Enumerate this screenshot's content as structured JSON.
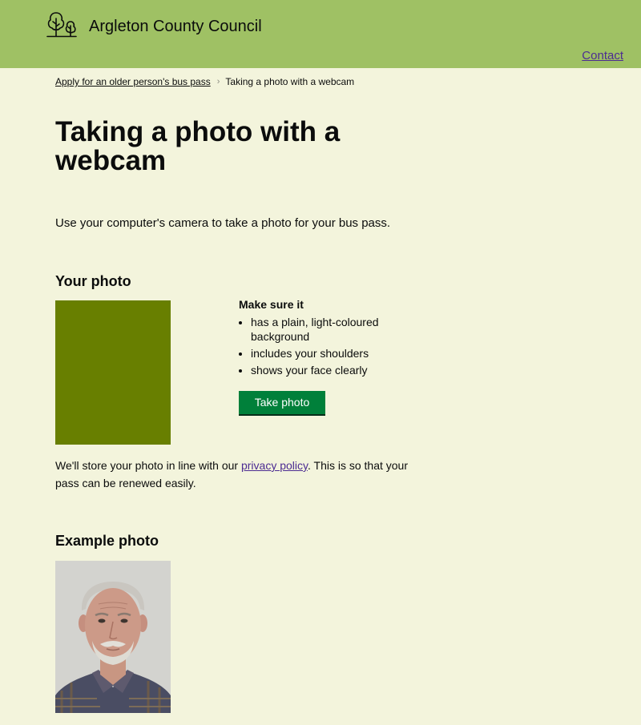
{
  "header": {
    "site_name": "Argleton County Council",
    "logo_icon": "trees-icon",
    "contact_label": "Contact",
    "background_color": "#9fc164"
  },
  "breadcrumb": {
    "items": [
      {
        "label": "Apply for an older person's bus pass"
      },
      {
        "label": "Taking a photo with a webcam"
      }
    ],
    "separator_icon": "chevron-right-icon"
  },
  "main": {
    "title": "Taking a photo with a webcam",
    "intro": "Use your computer's camera to take a photo for your bus pass.",
    "your_photo": {
      "heading": "Your photo",
      "requirements_title": "Make sure it",
      "requirements": [
        "has a plain, light-coloured background",
        "includes your shoulders",
        "shows your face clearly"
      ],
      "take_photo_label": "Take photo",
      "store_text_before": "We'll store your photo in line with our ",
      "privacy_link_label": "privacy policy",
      "store_text_after": ". This is so that your pass can be renewed easily."
    },
    "example_photo": {
      "heading": "Example photo"
    }
  },
  "colors": {
    "page_background": "#f3f4dc",
    "button": "#00803a",
    "link": "#4c2c92",
    "webcam_preview": "#687f00"
  }
}
